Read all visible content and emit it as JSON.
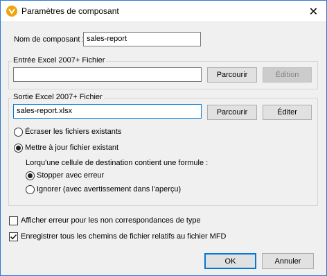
{
  "window": {
    "title": "Paramètres de composant",
    "close_glyph": "✕",
    "app_icon": "altova-mapforce-icon"
  },
  "component_name": {
    "label": "Nom de composant :",
    "value": "sales-report"
  },
  "input_group": {
    "title": "Entrée Excel 2007+ Fichier",
    "path_value": "",
    "browse_label": "Parcourir",
    "edit_label": "Édition",
    "edit_disabled": true
  },
  "output_group": {
    "title": "Sortie Excel 2007+ Fichier",
    "path_value": "sales-report.xlsx",
    "browse_label": "Parcourir",
    "edit_label": "Éditer",
    "radio_overwrite": {
      "label": "Écraser les fichiers existants",
      "selected": false
    },
    "radio_update": {
      "label": "Mettre à jour fichier existant",
      "selected": true
    },
    "formula_label": "Lorqu'une cellule de destination contient une formule :",
    "radio_stop": {
      "label": "Stopper avec erreur",
      "selected": true
    },
    "radio_ignore": {
      "label": "Ignorer (avec avertissement dans l'aperçu)",
      "selected": false
    }
  },
  "options": {
    "type_mismatch": {
      "label": "Afficher erreur pour les non correspondances de type",
      "checked": false
    },
    "relative_paths": {
      "label": "Enregistrer tous les chemins de fichier relatifs au fichier MFD",
      "checked": true
    }
  },
  "footer": {
    "ok_label": "OK",
    "cancel_label": "Annuler"
  },
  "colors": {
    "accent": "#0078d7",
    "icon": "#f0a30a",
    "dialog_bg": "#f0f0f0"
  }
}
